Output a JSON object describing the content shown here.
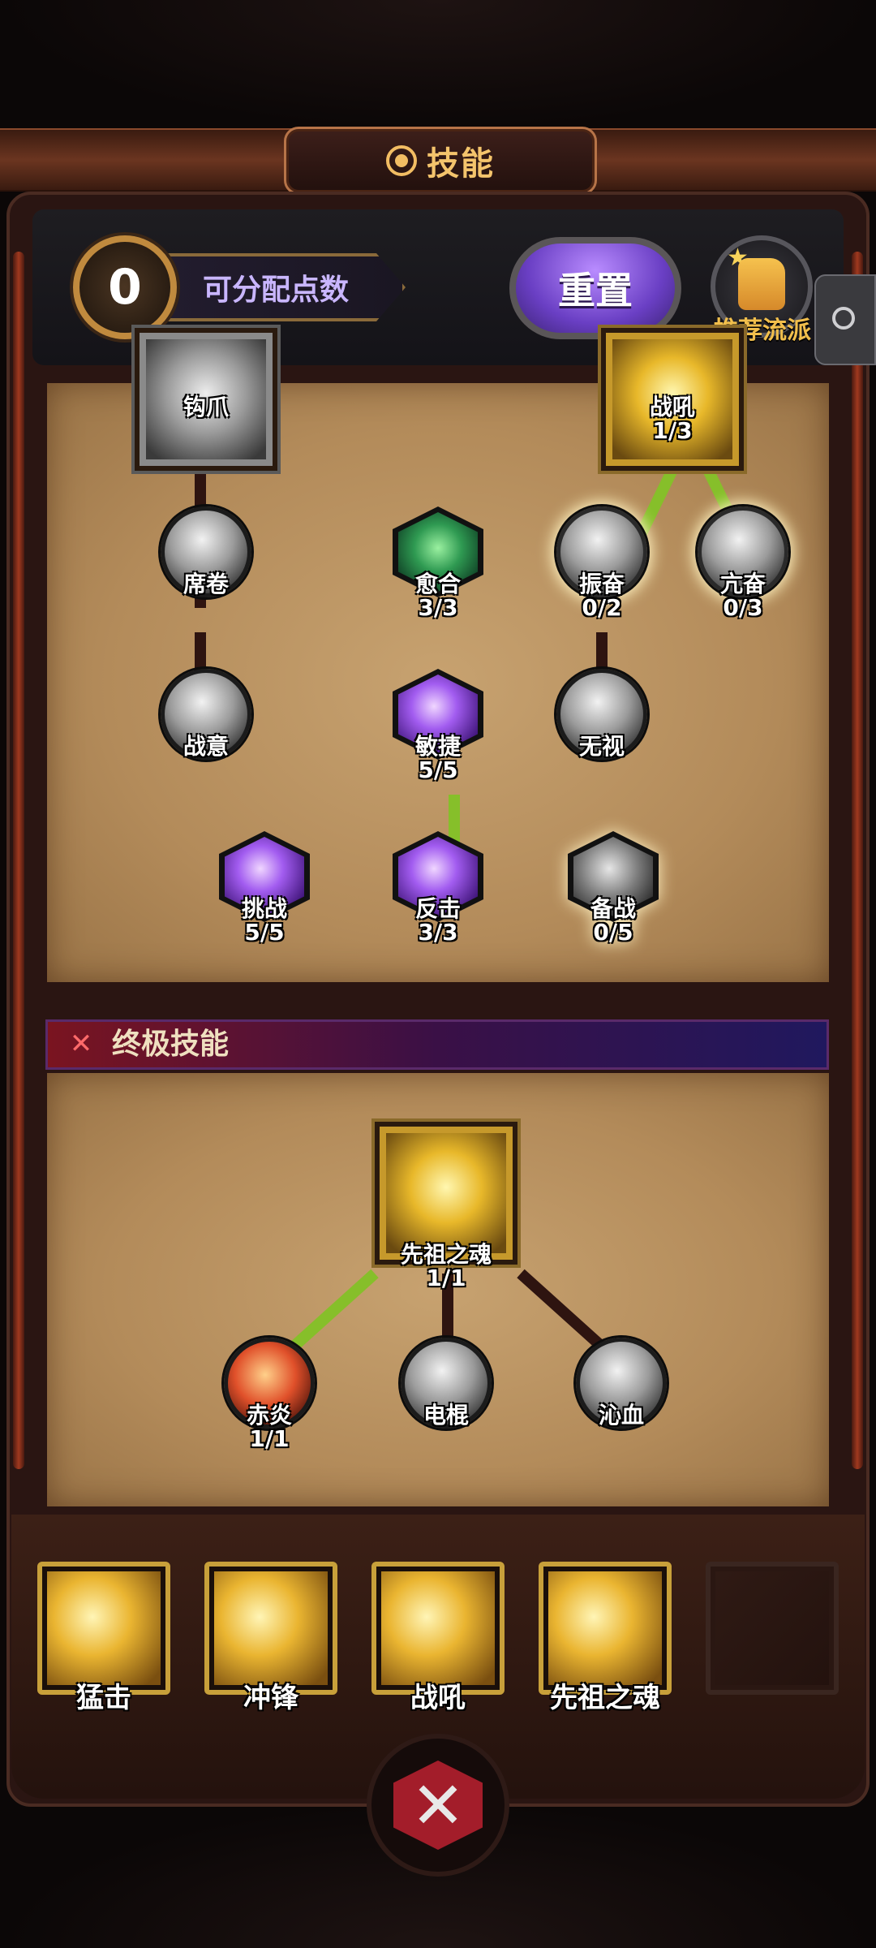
{
  "title": "技能",
  "header": {
    "available_points": "0",
    "points_label": "可分配点数",
    "reset_label": "重置",
    "recommend_label": "推荐流派"
  },
  "tree": {
    "nodes": [
      {
        "name": "钩爪",
        "count": ""
      },
      {
        "name": "战吼",
        "count": "1/3"
      },
      {
        "name": "席卷",
        "count": ""
      },
      {
        "name": "愈合",
        "count": "3/3"
      },
      {
        "name": "振奋",
        "count": "0/2"
      },
      {
        "name": "亢奋",
        "count": "0/3"
      },
      {
        "name": "战意",
        "count": ""
      },
      {
        "name": "敏捷",
        "count": "5/5"
      },
      {
        "name": "无视",
        "count": ""
      },
      {
        "name": "挑战",
        "count": "5/5"
      },
      {
        "name": "反击",
        "count": "3/3"
      },
      {
        "name": "备战",
        "count": "0/5"
      }
    ]
  },
  "ultimate": {
    "section_title": "终极技能",
    "nodes": [
      {
        "name": "先祖之魂",
        "count": "1/1"
      },
      {
        "name": "赤炎",
        "count": "1/1"
      },
      {
        "name": "电棍",
        "count": ""
      },
      {
        "name": "沁血",
        "count": ""
      }
    ]
  },
  "equipped": [
    {
      "label": "猛击"
    },
    {
      "label": "冲锋"
    },
    {
      "label": "战吼"
    },
    {
      "label": "先祖之魂"
    },
    {
      "label": ""
    }
  ],
  "colors": {
    "accent_gold": "#f4c46c",
    "active_link": "#86bf2a",
    "reset_purple": "#8a5ce6"
  }
}
